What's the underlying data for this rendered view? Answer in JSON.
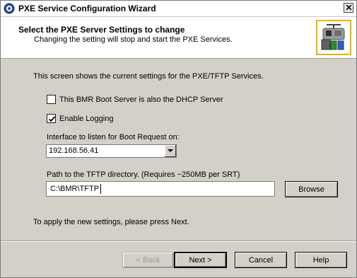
{
  "window": {
    "title": "PXE Service Configuration Wizard",
    "close_label": "✕"
  },
  "header": {
    "title": "Select the PXE Server Settings to change",
    "subtitle": "Changing the setting will stop and start the PXE Services."
  },
  "body": {
    "intro": "This screen shows the current settings for the PXE/TFTP Services.",
    "dhcp_checkbox": {
      "label": "This BMR Boot Server is also the DHCP Server",
      "checked": false
    },
    "logging_checkbox": {
      "label": "Enable Logging",
      "checked": true
    },
    "interface_label": "Interface to listen for Boot Request on:",
    "interface_value": "192.168.56.41",
    "path_label": "Path to the TFTP directory. (Requires ~250MB per SRT)",
    "path_value": "C:\\BMR\\TFTP",
    "browse_label": "Browse",
    "apply_note": "To apply the new settings, please press Next."
  },
  "footer": {
    "back_label": "< Back",
    "next_label": "Next >",
    "cancel_label": "Cancel",
    "help_label": "Help"
  },
  "icons": {
    "title": "wizard-gear-icon",
    "header": "network-server-icon",
    "combo": "chevron-down-icon"
  },
  "colors": {
    "dialog_bg": "#d4d0c8",
    "header_bg": "#ffffff",
    "logo_border": "#e8b400"
  }
}
